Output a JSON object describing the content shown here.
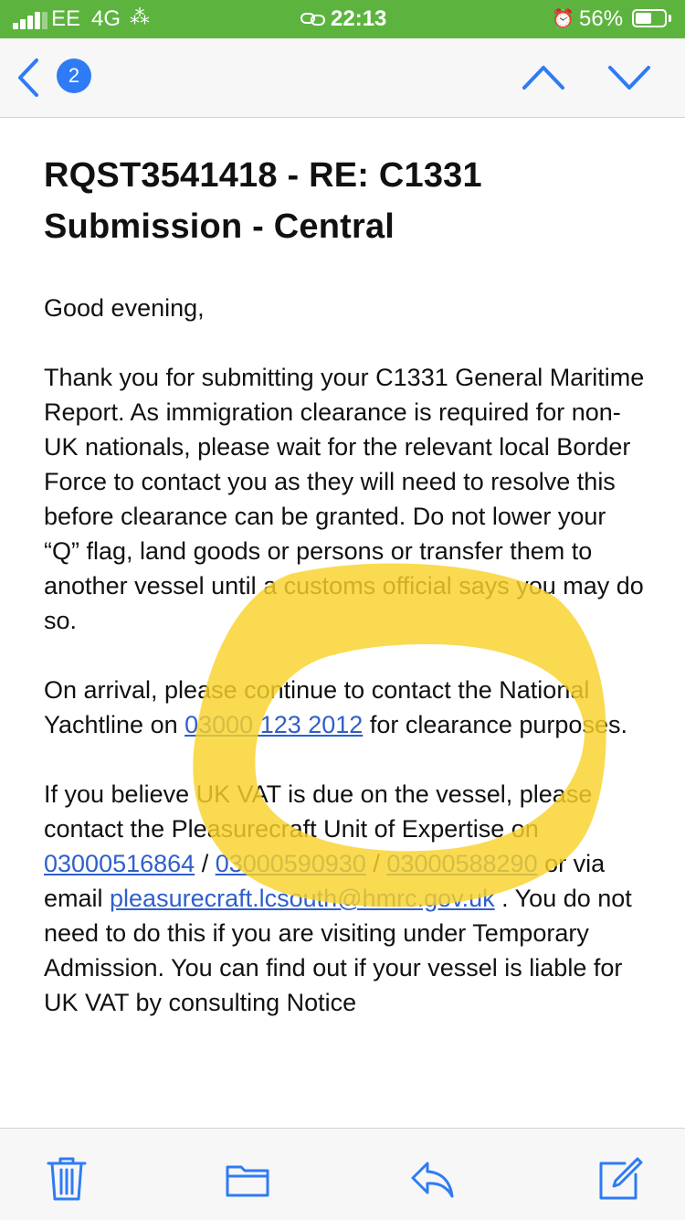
{
  "status_bar": {
    "carrier": "EE",
    "network": "4G",
    "time": "22:13",
    "battery_percent": "56%",
    "battery_level": 0.56
  },
  "nav": {
    "unread_count": "2",
    "icons": [
      "back-chevron-icon",
      "previous-message-icon",
      "next-message-icon"
    ]
  },
  "email": {
    "subject": "RQST3541418 - RE: C1331 Submission - Central",
    "greeting": "Good evening,",
    "para1": "Thank you for submitting your C1331 General Maritime Report. As immigration clearance is required for non-UK nationals, please wait for the relevant local Border Force to contact you as they will need to resolve this before clearance can be granted. Do not lower your “Q” flag, land goods or persons or transfer them to another vessel until a customs official says you may do so.",
    "para2_before": "On arrival, please continue to contact the National Yachtline on ",
    "phone_yachtline": "03000 123 2012",
    "para2_after": " for clearance purposes.",
    "para3_part1": "If you believe UK VAT is due on the vessel, please contact the Pleasurecraft Unit of Expertise on ",
    "phone1": "03000516864",
    "sep1": " / ",
    "phone2": "03000590930",
    "sep2": " / ",
    "phone3": "03000588290",
    "para3_part2": " or via email ",
    "email_link": "pleasurecraft.lcsouth@hmrc.gov.uk",
    "para3_part3": " . You do not need to do this if you are visiting under Temporary Admission. You can find out if your vessel is liable for UK VAT by consulting Notice"
  },
  "toolbar": {
    "icons": [
      "trash-icon",
      "folder-icon",
      "reply-icon",
      "compose-icon"
    ]
  },
  "colors": {
    "status_bar": "#5cb43f",
    "accent": "#2f7bf5",
    "link": "#2f5fcc",
    "highlight": "#f9d22a"
  }
}
